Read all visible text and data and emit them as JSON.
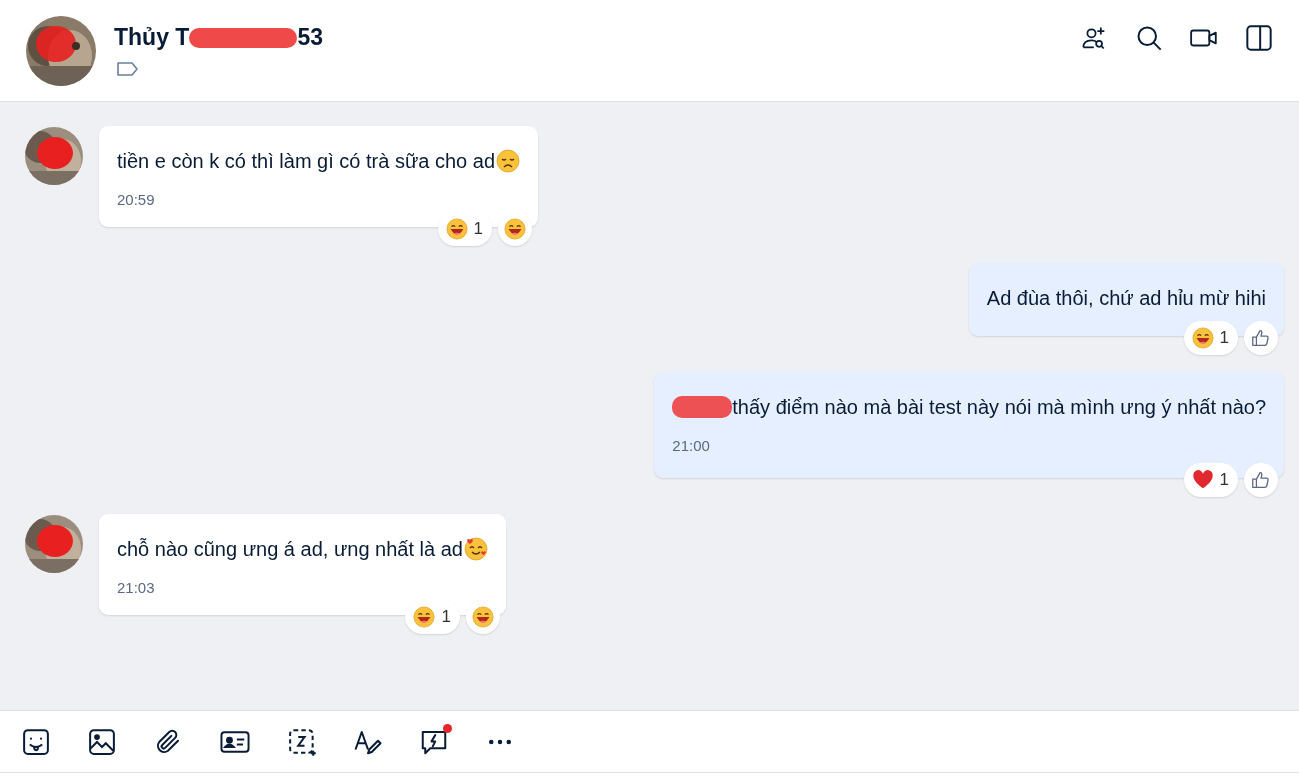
{
  "conversation": {
    "name_start": "Thủy T",
    "name_end": "53",
    "name_redacted": true
  },
  "messages": [
    {
      "kind": "incoming",
      "redacted_prefix": false,
      "text": "tiền e còn k có thì làm gì có trà sữa cho ad",
      "emoji": {
        "kind": "sad"
      },
      "time": "20:59",
      "reactions": [
        {
          "kind": "laugh",
          "count": "1"
        }
      ],
      "quick_reaction": {
        "kind": "laugh"
      }
    },
    {
      "kind": "outgoing",
      "redacted_prefix": false,
      "text": "Ad đùa thôi, chứ ad hỉu mừ hihi",
      "reactions": [
        {
          "kind": "laugh",
          "count": "1"
        }
      ],
      "quick_reaction": {
        "kind": "thumb"
      }
    },
    {
      "kind": "outgoing",
      "redacted_prefix": true,
      "text": "thấy điểm nào mà bài test này nói mà mình ưng ý nhất nào?",
      "time": "21:00",
      "reactions": [
        {
          "kind": "heart",
          "count": "1"
        }
      ],
      "quick_reaction": {
        "kind": "thumb"
      }
    },
    {
      "kind": "incoming",
      "redacted_prefix": false,
      "text": "chỗ nào cũng ưng á ad, ưng nhất là ad",
      "emoji": {
        "kind": "love"
      },
      "time": "21:03",
      "reactions": [
        {
          "kind": "laugh",
          "count": "1"
        }
      ],
      "quick_reaction": {
        "kind": "laugh"
      }
    }
  ],
  "toolbar": {
    "quick_message_unread": true
  }
}
